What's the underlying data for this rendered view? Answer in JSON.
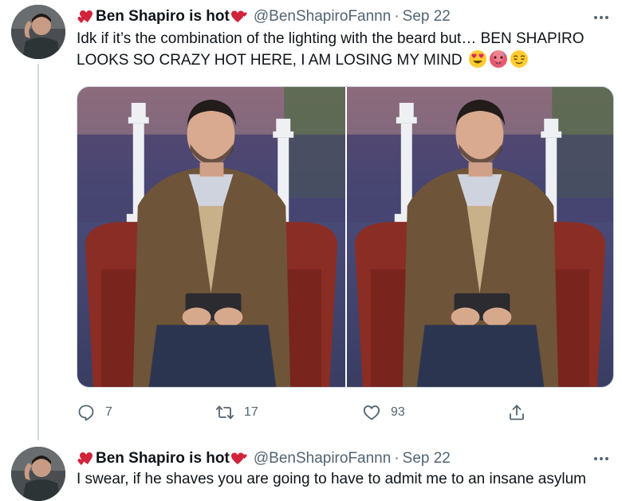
{
  "tweets": [
    {
      "display_name": "Ben Shapiro is hot",
      "handle": "@BenShapiroFannn",
      "separator": "·",
      "date": "Sep 22",
      "text": "Idk if it’s the combination of the lighting with the beard but… BEN SHAPIRO LOOKS SO CRAZY HOT HERE, I AM LOSING MY MIND",
      "emojis": [
        "smiling-face-with-heart-eyes",
        "hot-face",
        "relieved-face"
      ],
      "media": [
        "photo-1",
        "photo-2"
      ],
      "actions": {
        "reply_count": "7",
        "retweet_count": "17",
        "like_count": "93"
      }
    },
    {
      "display_name": "Ben Shapiro is hot",
      "handle": "@BenShapiroFannn",
      "separator": "·",
      "date": "Sep 22",
      "text": "I swear, if he shaves you are going to have to admit me to an insane asylum"
    }
  ],
  "colors": {
    "text": "#0f1419",
    "secondary": "#536471",
    "heart": "#d0243b",
    "divider": "#cfd9de"
  },
  "icons": [
    "heart-emoji-icon",
    "more-icon",
    "reply-icon",
    "retweet-icon",
    "like-icon",
    "share-icon"
  ]
}
